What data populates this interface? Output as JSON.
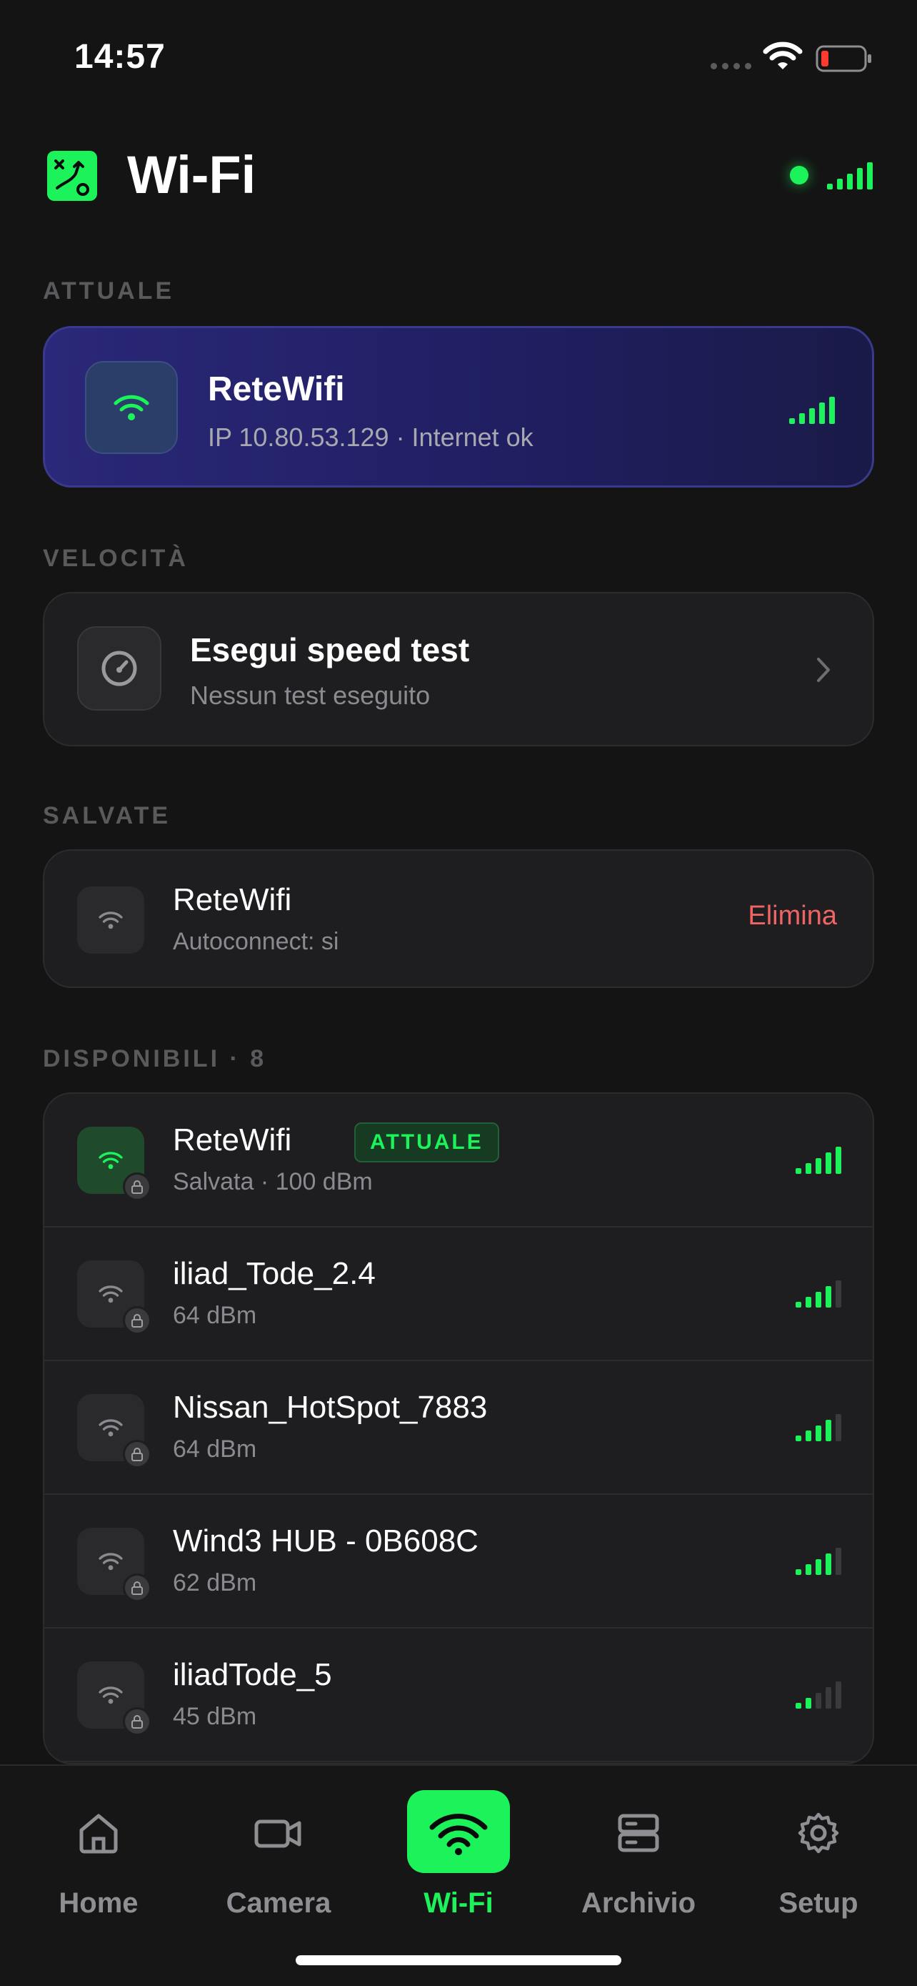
{
  "status_bar": {
    "time": "14:57"
  },
  "header": {
    "title": "Wi-Fi"
  },
  "sections": {
    "current": "ATTUALE",
    "speed": "VELOCITÀ",
    "saved": "SALVATE",
    "available": "DISPONIBILI · 8"
  },
  "current_network": {
    "name": "ReteWifi",
    "details": "IP 10.80.53.129 · Internet ok",
    "signal_bars": 5
  },
  "speed_test": {
    "title": "Esegui speed test",
    "subtitle": "Nessun test eseguito"
  },
  "saved_networks": [
    {
      "name": "ReteWifi",
      "detail": "Autoconnect: si",
      "action": "Elimina"
    }
  ],
  "available_networks": [
    {
      "name": "ReteWifi",
      "badge": "ATTUALE",
      "detail": "Salvata · 100 dBm",
      "signal_bars": 5,
      "active": true
    },
    {
      "name": "iliad_Tode_2.4",
      "detail": "64 dBm",
      "signal_bars": 4
    },
    {
      "name": "Nissan_HotSpot_7883",
      "detail": "64 dBm",
      "signal_bars": 4
    },
    {
      "name": "Wind3 HUB - 0B608C",
      "detail": "62 dBm",
      "signal_bars": 4
    },
    {
      "name": "iliadTode_5",
      "detail": "45 dBm",
      "signal_bars": 2
    }
  ],
  "tabs": [
    {
      "label": "Home",
      "icon": "home-icon"
    },
    {
      "label": "Camera",
      "icon": "camera-icon"
    },
    {
      "label": "Wi-Fi",
      "icon": "wifi-icon",
      "active": true
    },
    {
      "label": "Archivio",
      "icon": "archive-icon"
    },
    {
      "label": "Setup",
      "icon": "gear-icon"
    }
  ],
  "colors": {
    "accent": "#1cf35b",
    "danger": "#f06464",
    "background": "#141414",
    "card": "#1e1e20"
  }
}
